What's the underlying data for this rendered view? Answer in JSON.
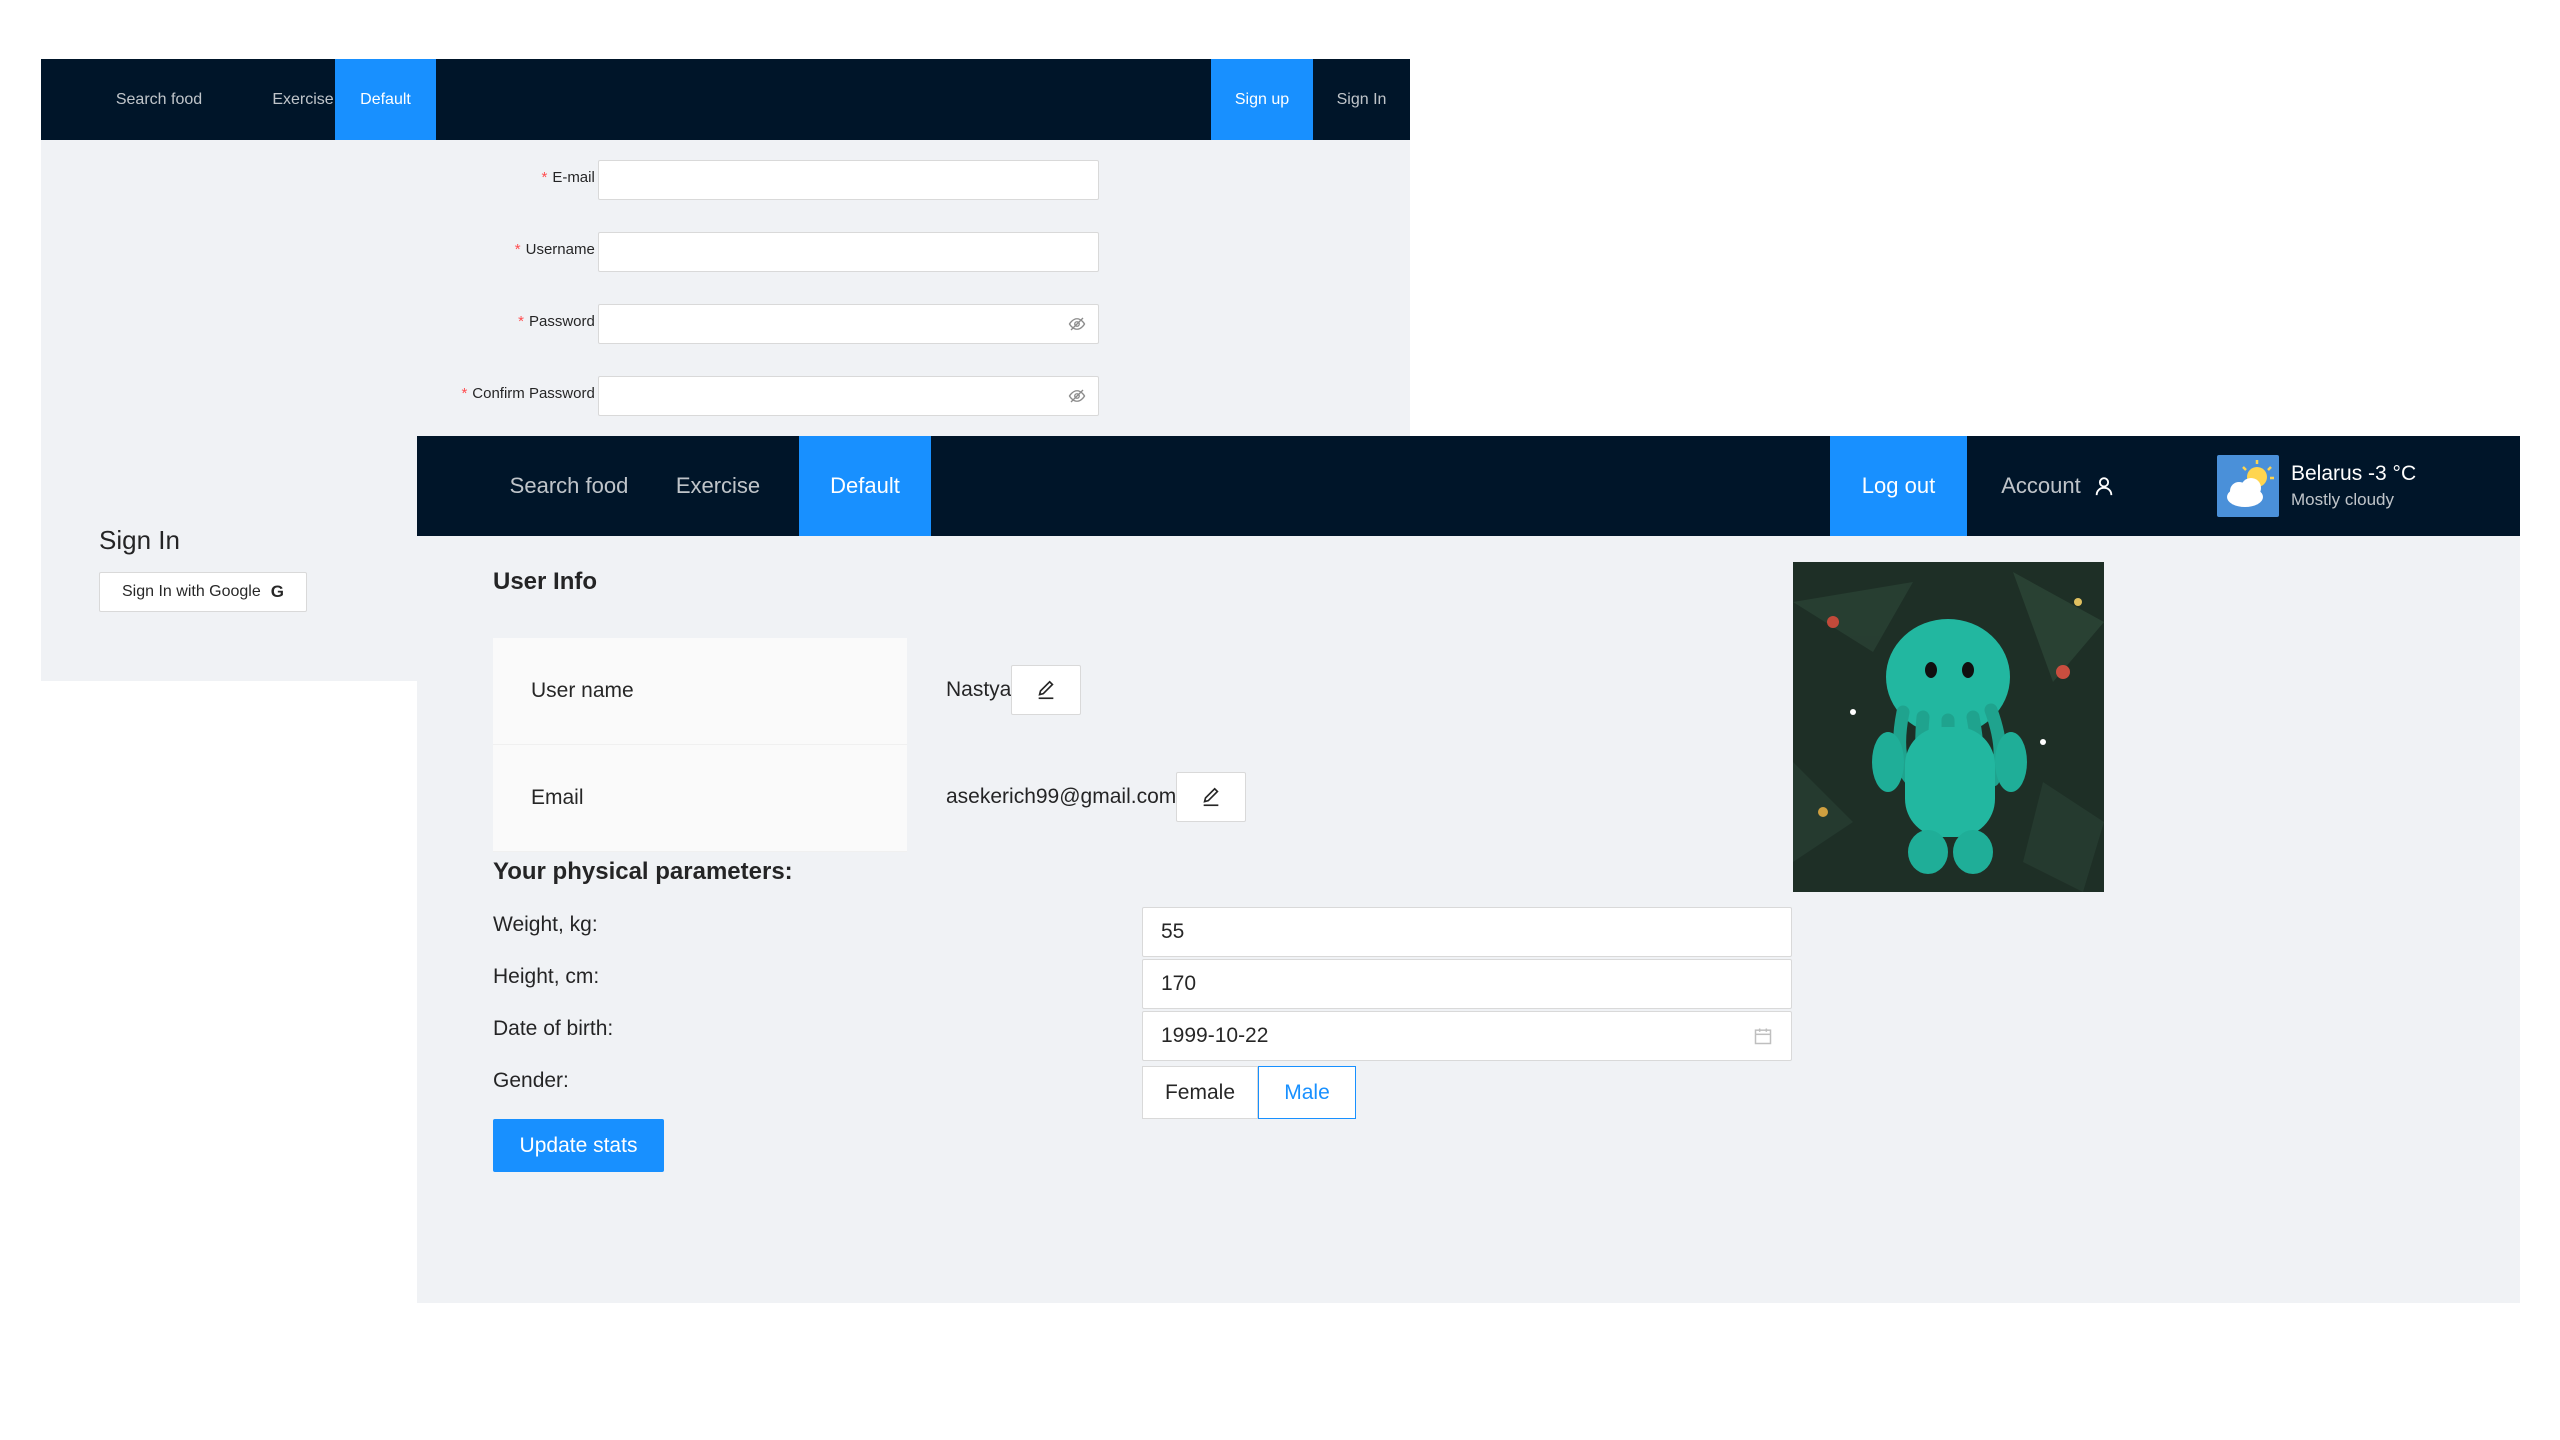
{
  "back": {
    "nav": {
      "search_food": "Search food",
      "exercise": "Exercise",
      "default": "Default",
      "sign_up": "Sign up",
      "sign_in": "Sign In"
    },
    "form": {
      "email_label": "E-mail",
      "username_label": "Username",
      "password_label": "Password",
      "confirm_label": "Confirm Password",
      "required_mark": "*",
      "colon": ":"
    },
    "signin": {
      "title": "Sign In",
      "google_label": "Sign In with Google",
      "google_glyph": "G"
    }
  },
  "front": {
    "nav": {
      "search_food": "Search food",
      "exercise": "Exercise",
      "default": "Default",
      "log_out": "Log out",
      "account": "Account"
    },
    "weather": {
      "temp": "Belarus  -3 °C",
      "desc": "Mostly cloudy",
      "icon": "partly-cloudy-icon"
    },
    "user_info": {
      "title": "User Info",
      "username_label": "User name",
      "username_value": "Nastya",
      "email_label": "Email",
      "email_value": "asekerich99@gmail.com"
    },
    "physical": {
      "title": "Your physical parameters:",
      "weight_label": "Weight, kg:",
      "weight_value": "55",
      "height_label": "Height, cm:",
      "height_value": "170",
      "dob_label": "Date of birth:",
      "dob_value": "1999-10-22",
      "gender_label": "Gender:",
      "gender_options": [
        "Female",
        "Male"
      ],
      "gender_selected": "Male",
      "update_label": "Update stats"
    }
  },
  "colors": {
    "nav_bg": "#001529",
    "primary": "#1890ff",
    "page_bg": "#f0f2f5"
  }
}
